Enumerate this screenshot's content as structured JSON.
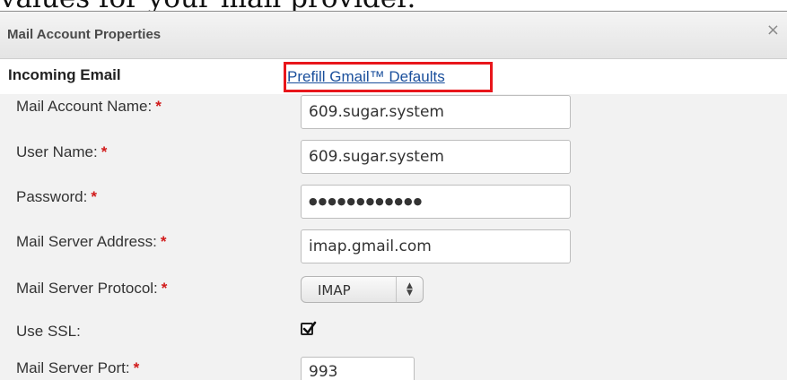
{
  "background_caption": "values for your mail provider.",
  "dialog": {
    "title": "Mail Account Properties",
    "close_glyph": "×",
    "close_icon": "close-icon"
  },
  "section": {
    "title": "Incoming Email",
    "prefill_link": "Prefill Gmail™ Defaults",
    "highlight_color": "#e8161b"
  },
  "required_marker": "*",
  "fields": {
    "mail_account_name": {
      "label": "Mail Account Name:",
      "value": "609.sugar.system",
      "required": true
    },
    "user_name": {
      "label": "User Name:",
      "value": "609.sugar.system",
      "required": true
    },
    "password": {
      "label": "Password:",
      "value": "●●●●●●●●●●●●",
      "required": true
    },
    "mail_server_address": {
      "label": "Mail Server Address:",
      "value": "imap.gmail.com",
      "required": true
    },
    "mail_server_protocol": {
      "label": "Mail Server Protocol:",
      "value": "IMAP",
      "required": true
    },
    "use_ssl": {
      "label": "Use SSL:",
      "checked": true,
      "required": false
    },
    "mail_server_port": {
      "label": "Mail Server Port:",
      "value": "993",
      "required": true
    }
  },
  "colors": {
    "link": "#1a4f9c",
    "required": "#d11a1a",
    "form_background": "#f2f2f2"
  }
}
